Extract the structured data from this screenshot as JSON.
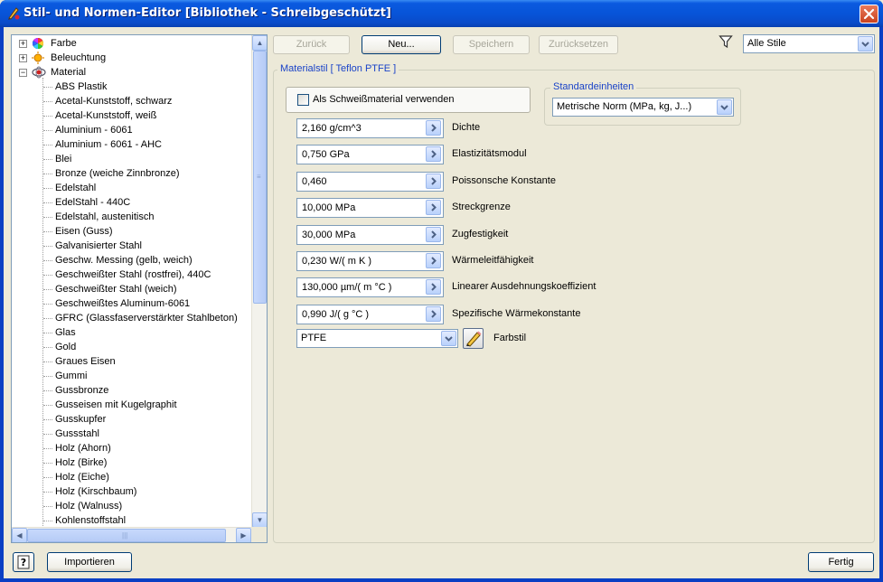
{
  "window": {
    "title": "Stil- und Normen-Editor [Bibliothek - Schreibgeschützt]"
  },
  "tree": {
    "roots": [
      {
        "label": "Farbe",
        "expander": "+",
        "icon": "color-wheel-icon"
      },
      {
        "label": "Beleuchtung",
        "expander": "+",
        "icon": "light-icon"
      },
      {
        "label": "Material",
        "expander": "−",
        "icon": "material-icon"
      }
    ],
    "materials": [
      "ABS Plastik",
      "Acetal-Kunststoff, schwarz",
      "Acetal-Kunststoff, weiß",
      "Aluminium - 6061",
      "Aluminium - 6061 - AHC",
      "Blei",
      "Bronze (weiche Zinnbronze)",
      "Edelstahl",
      "EdelStahl - 440C",
      "Edelstahl, austenitisch",
      "Eisen (Guss)",
      "Galvanisierter Stahl",
      "Geschw. Messing (gelb, weich)",
      "Geschweißter Stahl (rostfrei), 440C",
      "Geschweißter Stahl (weich)",
      "Geschweißtes Aluminum-6061",
      "GFRC (Glassfaserverstärkter Stahlbeton)",
      "Glas",
      "Gold",
      "Graues Eisen",
      "Gummi",
      "Gussbronze",
      "Gusseisen mit Kugelgraphit",
      "Gusskupfer",
      "Gussstahl",
      "Holz (Ahorn)",
      "Holz (Birke)",
      "Holz (Eiche)",
      "Holz (Kirschbaum)",
      "Holz (Walnuss)",
      "Kohlenstoffstahl"
    ]
  },
  "toolbar": {
    "back_label": "Zurück",
    "new_label": "Neu...",
    "save_label": "Speichern",
    "reset_label": "Zurücksetzen",
    "filter_value": "Alle Stile"
  },
  "material_group": {
    "title": "Materialstil [ Teflon PTFE ]",
    "weld_checkbox_label": "Als Schweißmaterial verwenden",
    "weld_checked": false,
    "units_legend": "Standardeinheiten",
    "units_value": "Metrische Norm (MPa, kg, J...)"
  },
  "properties": [
    {
      "value": "2,160 g/cm^3",
      "label": "Dichte"
    },
    {
      "value": "0,750 GPa",
      "label": "Elastizitätsmodul"
    },
    {
      "value": "0,460",
      "label": "Poissonsche Konstante"
    },
    {
      "value": "10,000 MPa",
      "label": "Streckgrenze"
    },
    {
      "value": "30,000 MPa",
      "label": "Zugfestigkeit"
    },
    {
      "value": "0,230 W/( m K )",
      "label": "Wärmeleitfähigkeit"
    },
    {
      "value": "130,000 µm/( m °C )",
      "label": "Linearer Ausdehnungskoeffizient"
    },
    {
      "value": "0,990 J/( g °C )",
      "label": "Spezifische Wärmekonstante"
    }
  ],
  "color_style": {
    "value": "PTFE",
    "label": "Farbstil"
  },
  "footer": {
    "help_label": "?",
    "import_label": "Importieren",
    "done_label": "Fertig"
  },
  "colors": {
    "title_bar": "#0754d8",
    "window_bg": "#ece9d8",
    "group_title": "#1a43c8",
    "field_border": "#7f9db9"
  }
}
